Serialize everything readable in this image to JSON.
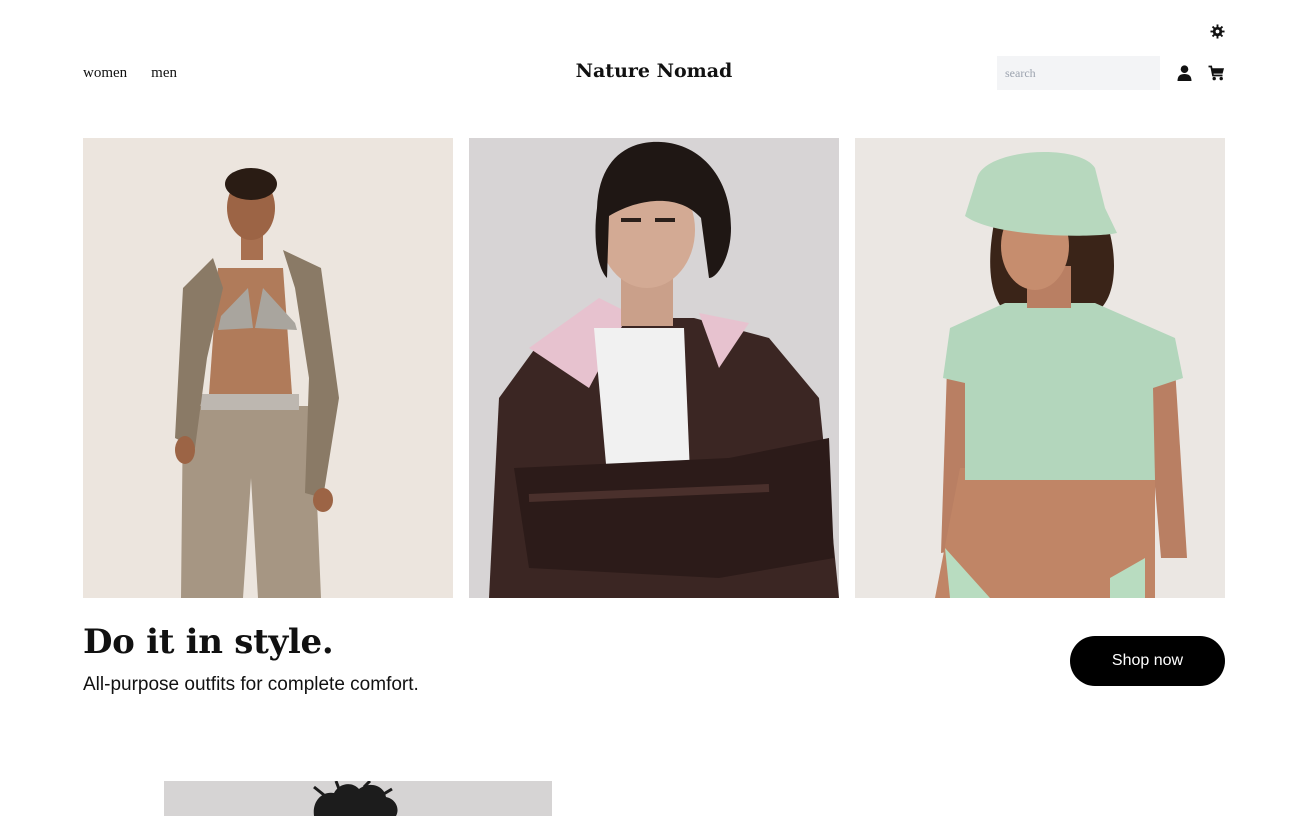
{
  "header": {
    "nav": [
      {
        "label": "women"
      },
      {
        "label": "men"
      }
    ],
    "brand": "Nature Nomad",
    "search": {
      "placeholder": "search",
      "value": ""
    },
    "icons": [
      "settings-gear-icon",
      "user-icon",
      "cart-icon"
    ]
  },
  "hero": {
    "images": [
      {
        "name": "woman-linen-outfit",
        "background": "#ece5de"
      },
      {
        "name": "man-leather-jacket",
        "background": "#d7d4d5"
      },
      {
        "name": "woman-mint-crop-top",
        "background": "#ebe7e3"
      }
    ]
  },
  "promo": {
    "headline": "Do it in style.",
    "subheadline": "All-purpose outfits for complete comfort.",
    "cta_label": "Shop now"
  },
  "colors": {
    "text": "#111111",
    "button": "#000000",
    "search_bg": "#f3f4f6"
  }
}
